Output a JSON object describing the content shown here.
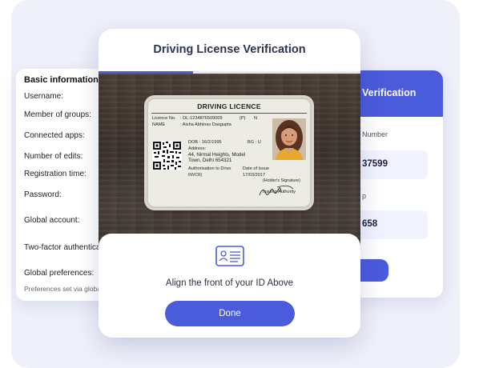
{
  "info_card": {
    "title": "Basic information",
    "rows": [
      "Username:",
      "Member of groups:",
      "Connected apps:",
      "Number of edits:",
      "Registration time:",
      "Password:",
      "Global account:",
      "Two-factor authentication",
      "Global preferences:"
    ],
    "note": "Preferences set via global"
  },
  "verif_card": {
    "title": "Verification",
    "label1": "Number",
    "value1": "37599",
    "label2": "p",
    "value2": "658"
  },
  "modal": {
    "title": "Driving License Verification",
    "progress": 0.36
  },
  "licence": {
    "header": "DRIVING LICENCE",
    "licence_no_label": "Licence No.",
    "licence_no": ": DL-1234876509009",
    "flag_p": "(P)",
    "flag_n": "N",
    "name_label": "NAME",
    "name": ": Aisha Abhinav Dasgupta",
    "dob": "DOB : 16/2/1995",
    "bg": "BG : U",
    "address_label": "Address:",
    "address_line1": "44, Nirmal Heights, Model",
    "address_line2": "Town, Delhi 654321",
    "auth_label": "Authorisation to Drive",
    "auth_value": "INVCR)",
    "issue_label": "Date of Issue",
    "issue_value": "17/03/2017",
    "holder_sig": "(Holder's Signature)",
    "issuing_authority": "Issuing Authority"
  },
  "sheet": {
    "instruction": "Align the front of your ID Above",
    "done_label": "Done"
  },
  "colors": {
    "accent": "#4a5bdc",
    "panel_bg": "#eef0fa"
  }
}
